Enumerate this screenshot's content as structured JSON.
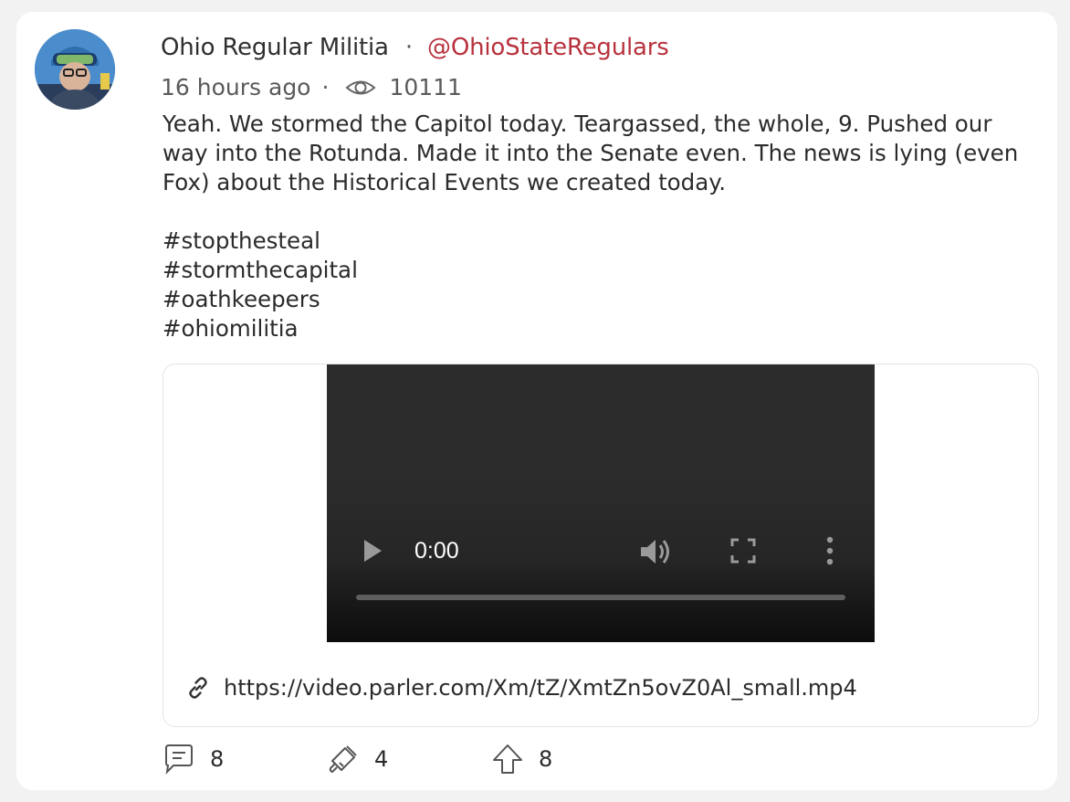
{
  "post": {
    "author_name": "Ohio Regular Militia",
    "separator": "·",
    "handle": "@OhioStateRegulars",
    "time_ago": "16 hours ago",
    "meta_dot": "·",
    "views": "10111",
    "body": "Yeah. We stormed the Capitol today. Teargassed, the whole, 9. Pushed our way into the Rotunda. Made it into the Senate even. The news is lying (even Fox) about the Historical Events we created today.",
    "hashtags": [
      "#stopthesteal",
      "#stormthecapital",
      "#oathkeepers",
      "#ohiomilitia"
    ]
  },
  "video": {
    "time": "0:00",
    "url": "https://video.parler.com/Xm/tZ/XmtZn5ovZ0Al_small.mp4",
    "progress": 0
  },
  "actions": {
    "comments": "8",
    "echoes": "4",
    "upvotes": "8"
  },
  "icons": {
    "views": "eye-icon",
    "play": "play-icon",
    "volume": "volume-icon",
    "fullscreen": "fullscreen-icon",
    "more": "more-vertical-icon",
    "link": "link-icon",
    "comment": "comment-icon",
    "echo": "echo-megaphone-icon",
    "upvote": "upvote-arrow-icon"
  },
  "colors": {
    "handle": "#b8323d",
    "background": "#f2f2f2",
    "card": "#ffffff"
  }
}
